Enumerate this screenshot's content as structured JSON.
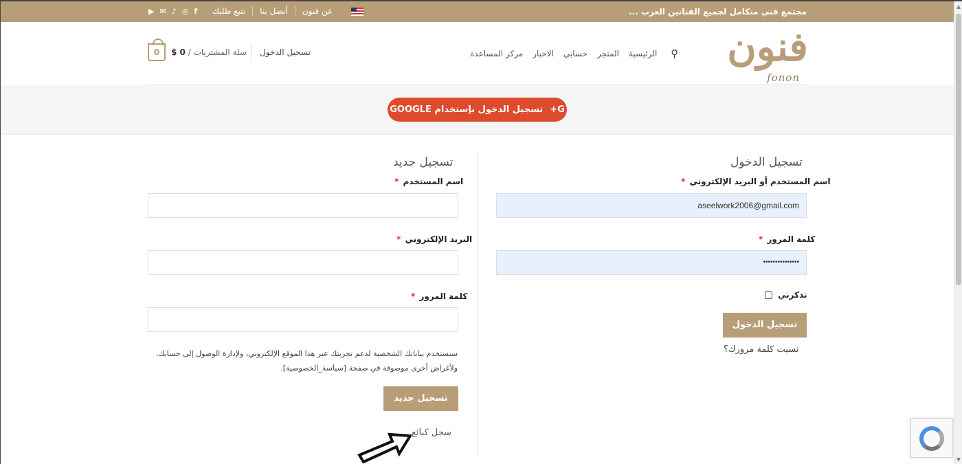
{
  "topbar": {
    "tagline": "مجتمع فني متكامل لجميع الفنانين العرب ...",
    "links": [
      "تتبع طلبك",
      "أتصل بنا",
      "عن فنون"
    ],
    "social_icons": [
      "youtube-icon",
      "email-icon",
      "tiktok-icon",
      "instagram-icon",
      "facebook-icon"
    ],
    "flag": "us-flag-icon"
  },
  "header": {
    "logo_ar": "فنون",
    "logo_en": "fonon",
    "nav": [
      "الرئيسية",
      "المتجر",
      "حسابي",
      "الاخبار",
      "مركز المساعدة"
    ],
    "account_link": "تسجيل الدخول",
    "cart_label": "سلة المشتريات /",
    "cart_total": "0 $",
    "cart_count": "0"
  },
  "google_login": {
    "label": "تسجيل الدخول بإستخدام GOOGLE",
    "icon": "G+"
  },
  "login": {
    "title": "تسجيل الدخول",
    "username_label": "اسم المستخدم أو البريد الإلكتروني",
    "username_value": "aseelwork2006@gmail.com",
    "password_label": "كلمة المرور",
    "password_value": "•••••••••••••••",
    "remember_label": "تذكرني",
    "submit_label": "تسجيل الدخول",
    "forgot_label": "نسيت كلمة مرورك؟",
    "required_mark": "*"
  },
  "register": {
    "title": "تسجيل جديد",
    "username_label": "اسم المستخدم",
    "email_label": "البريد الإلكتروني",
    "password_label": "كلمة المرور",
    "privacy_text": "سنستخدم بياناتك الشخصية لدعم تجربتك عبر هذا الموقع الإلكتروني، ولإدارة الوصول إلى حسابك، ولأغراض أخرى موصوفة في صفحة [سياسة_الخصوصية].",
    "submit_label": "تسجيل جديد",
    "vendor_label": "سجل كبائع",
    "required_mark": "*"
  },
  "colors": {
    "brand": "#b89e78",
    "google": "#de4b2c",
    "autofill": "#e8f0fe"
  }
}
